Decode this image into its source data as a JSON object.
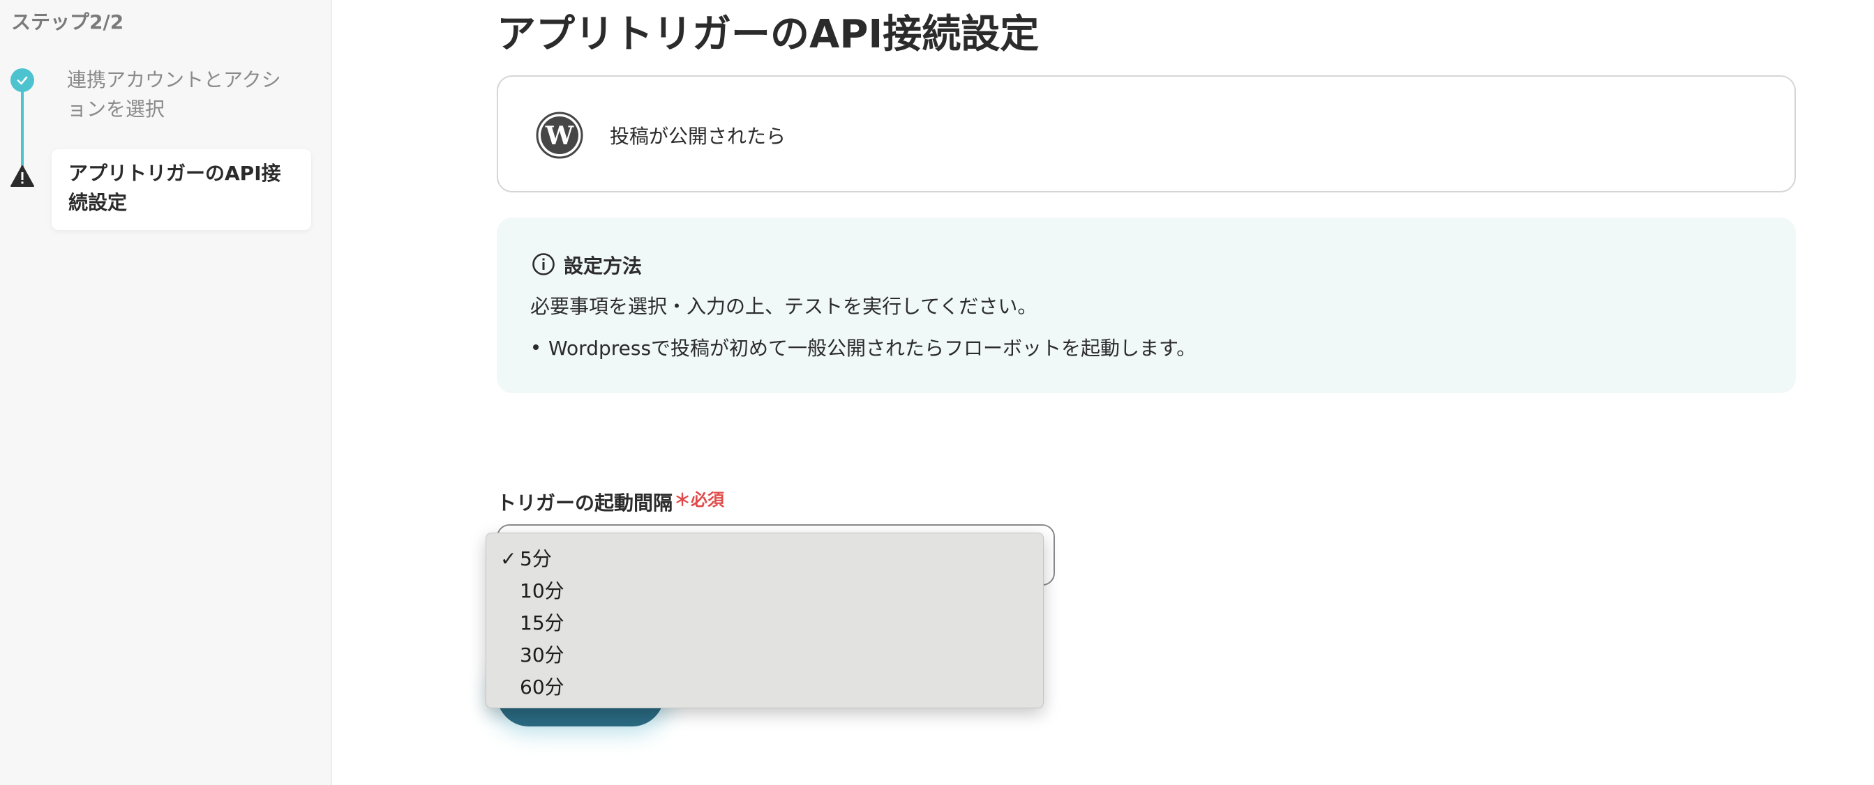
{
  "sidebar": {
    "header": "ステップ2/2",
    "steps": [
      {
        "label": "連携アカウントとアクションを選択",
        "status": "done"
      },
      {
        "label": "アプリトリガーのAPI接続設定",
        "status": "current-warning"
      }
    ]
  },
  "main": {
    "title": "アプリトリガーのAPI接続設定",
    "app_card": {
      "icon": "wordpress-icon",
      "label": "投稿が公開されたら"
    },
    "info": {
      "icon": "info-icon",
      "title": "設定方法",
      "text": "必要事項を選択・入力の上、テストを実行してください。",
      "bullets": [
        "Wordpressで投稿が初めて一般公開されたらフローボットを起動します。"
      ]
    },
    "field": {
      "label": "トリガーの起動間隔",
      "required": "＊必須",
      "selected": "5分"
    },
    "dropdown": {
      "options": [
        "5分",
        "10分",
        "15分",
        "30分",
        "60分"
      ],
      "check_mark": "✓"
    }
  },
  "colors": {
    "accent": "#4cc3cf",
    "button": "#2a6a82",
    "required": "#e04a4a",
    "info_bg": "#f1f8f8"
  }
}
